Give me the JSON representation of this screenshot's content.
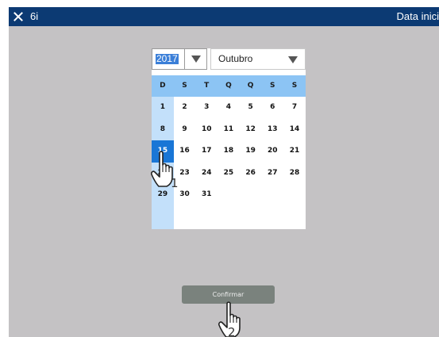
{
  "titlebar": {
    "close_icon": "close-icon",
    "app_name": "6i",
    "screen_title": "Data inici"
  },
  "date_picker": {
    "year": "2017",
    "month": "Outubro",
    "weekdays": [
      "D",
      "S",
      "T",
      "Q",
      "Q",
      "S",
      "S"
    ],
    "weeks": [
      [
        "1",
        "2",
        "3",
        "4",
        "5",
        "6",
        "7"
      ],
      [
        "8",
        "9",
        "10",
        "11",
        "12",
        "13",
        "14"
      ],
      [
        "15",
        "16",
        "17",
        "18",
        "19",
        "20",
        "21"
      ],
      [
        "22",
        "23",
        "24",
        "25",
        "26",
        "27",
        "28"
      ],
      [
        "29",
        "30",
        "31",
        "",
        "",
        "",
        ""
      ],
      [
        "",
        "",
        "",
        "",
        "",
        "",
        ""
      ]
    ],
    "selected_day": "15"
  },
  "confirm_label": "Confirmar",
  "annotations": {
    "step_1": "1",
    "step_2": "2"
  },
  "colors": {
    "titlebar": "#0c3a73",
    "background": "#c4c2c4",
    "weekday_header": "#8cc4f4",
    "sunday_column": "#c3e0fa",
    "selected_day": "#1976d6",
    "confirm_button": "#7a827d"
  }
}
